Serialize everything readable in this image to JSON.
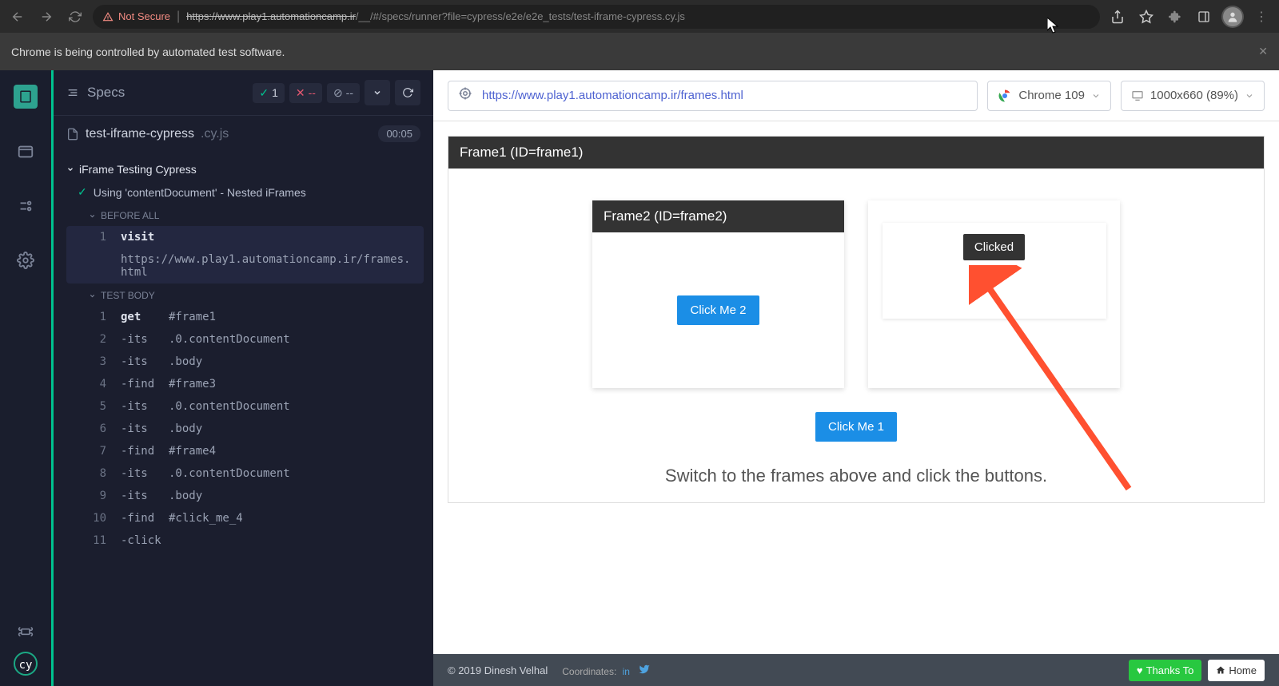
{
  "browser": {
    "not_secure": "Not Secure",
    "url_host": "https://www.play1.automationcamp.ir",
    "url_path": "/__/#/specs/runner?file=cypress/e2e/e2e_tests/test-iframe-cypress.cy.js"
  },
  "automation_banner": "Chrome is being controlled by automated test software.",
  "cypress": {
    "panel_title": "Specs",
    "stats": {
      "pass": "1",
      "fail": "--",
      "pending": "--"
    },
    "file_name": "test-iframe-cypress",
    "file_ext": ".cy.js",
    "timer": "00:05",
    "suite_title": "iFrame Testing Cypress",
    "test_title": "Using 'contentDocument' - Nested iFrames",
    "section_before": "BEFORE ALL",
    "section_body": "TEST BODY",
    "commands_before": [
      {
        "n": "1",
        "name": "visit",
        "arg": "https://www.play1.automationcamp.ir/frames.html",
        "child": false
      }
    ],
    "commands_body": [
      {
        "n": "1",
        "name": "get",
        "arg": "#frame1",
        "child": false
      },
      {
        "n": "2",
        "name": "-its",
        "arg": ".0.contentDocument",
        "child": true
      },
      {
        "n": "3",
        "name": "-its",
        "arg": ".body",
        "child": true
      },
      {
        "n": "4",
        "name": "-find",
        "arg": "#frame3",
        "child": true
      },
      {
        "n": "5",
        "name": "-its",
        "arg": ".0.contentDocument",
        "child": true
      },
      {
        "n": "6",
        "name": "-its",
        "arg": ".body",
        "child": true
      },
      {
        "n": "7",
        "name": "-find",
        "arg": "#frame4",
        "child": true
      },
      {
        "n": "8",
        "name": "-its",
        "arg": ".0.contentDocument",
        "child": true
      },
      {
        "n": "9",
        "name": "-its",
        "arg": ".body",
        "child": true
      },
      {
        "n": "10",
        "name": "-find",
        "arg": "#click_me_4",
        "child": true
      },
      {
        "n": "11",
        "name": "-click",
        "arg": "",
        "child": true
      }
    ]
  },
  "app": {
    "url": "https://www.play1.automationcamp.ir/frames.html",
    "browser_label": "Chrome 109",
    "viewport_label": "1000x660 (89%)",
    "frame1_title": "Frame1 (ID=frame1)",
    "frame2_title": "Frame2 (ID=frame2)",
    "click_me_2": "Click Me 2",
    "clicked": "Clicked",
    "click_me_1": "Click Me 1",
    "instruction": "Switch to the frames above and click the buttons."
  },
  "footer": {
    "copyright": "© 2019 Dinesh Velhal",
    "coords_label": "Coordinates:",
    "thanks": "Thanks To",
    "home": "Home"
  }
}
